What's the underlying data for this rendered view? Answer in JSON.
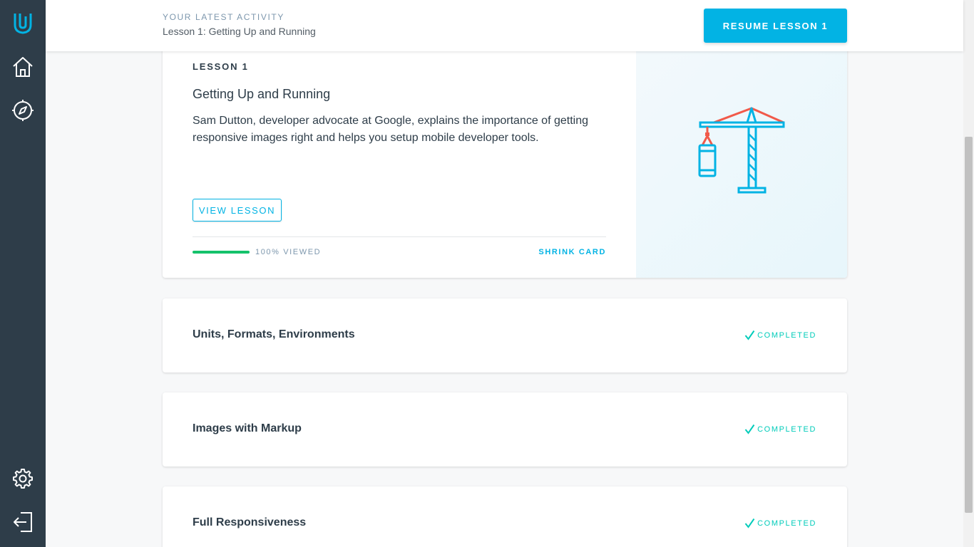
{
  "sidebar": {
    "icons": [
      "udacity-logo-icon",
      "home-icon",
      "compass-icon",
      "gear-icon",
      "logout-icon"
    ]
  },
  "header": {
    "activity_label": "YOUR LATEST ACTIVITY",
    "activity_lesson": "Lesson 1: Getting Up and Running",
    "resume_label": "RESUME LESSON 1"
  },
  "current_lesson": {
    "number_label": "LESSON 1",
    "title": "Getting Up and Running",
    "description": "Sam Dutton, developer advocate at Google, explains the importance of getting responsive images right and helps you setup mobile developer tools.",
    "view_label": "VIEW LESSON",
    "progress_fraction": 1.0,
    "viewed_label": "100% VIEWED",
    "shrink_label": "SHRINK CARD",
    "illustration": "crane-icon"
  },
  "lessons": [
    {
      "title": "Units, Formats, Environments",
      "status": "COMPLETED"
    },
    {
      "title": "Images with Markup",
      "status": "COMPLETED"
    },
    {
      "title": "Full Responsiveness",
      "status": "COMPLETED"
    }
  ],
  "colors": {
    "sidebar": "#2e3d49",
    "accent": "#02b3e4",
    "progress": "#15c26b",
    "completed": "#02ccba",
    "crane_red": "#f15a4a"
  }
}
